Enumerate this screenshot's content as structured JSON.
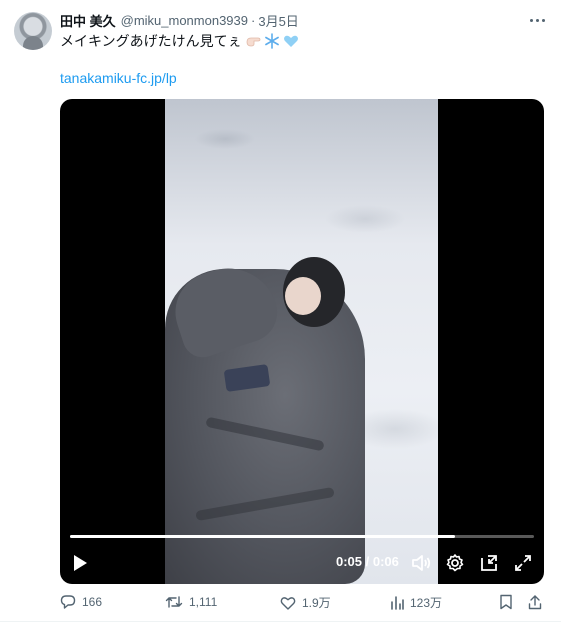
{
  "tweet": {
    "author_name": "田中 美久",
    "handle": "@miku_monmon3939",
    "separator": "·",
    "date": "3月5日",
    "text": "メイキングあげたけん見てぇ",
    "emojis": [
      "pointing-hand-emoji",
      "snowflake-emoji",
      "light-blue-heart-emoji"
    ],
    "link": "tanakamiku-fc.jp/lp"
  },
  "video": {
    "progress": 0.83,
    "time_display": "0:05 / 0:06",
    "controls": [
      "play-icon",
      "volume-icon",
      "settings-icon",
      "pip-icon",
      "fullscreen-icon"
    ]
  },
  "actions": {
    "replies": "166",
    "reposts": "1,111",
    "likes": "1.9万",
    "views": "123万"
  },
  "colors": {
    "link": "#1d9bf0",
    "secondary_text": "#536471",
    "primary_text": "#0f1419"
  }
}
